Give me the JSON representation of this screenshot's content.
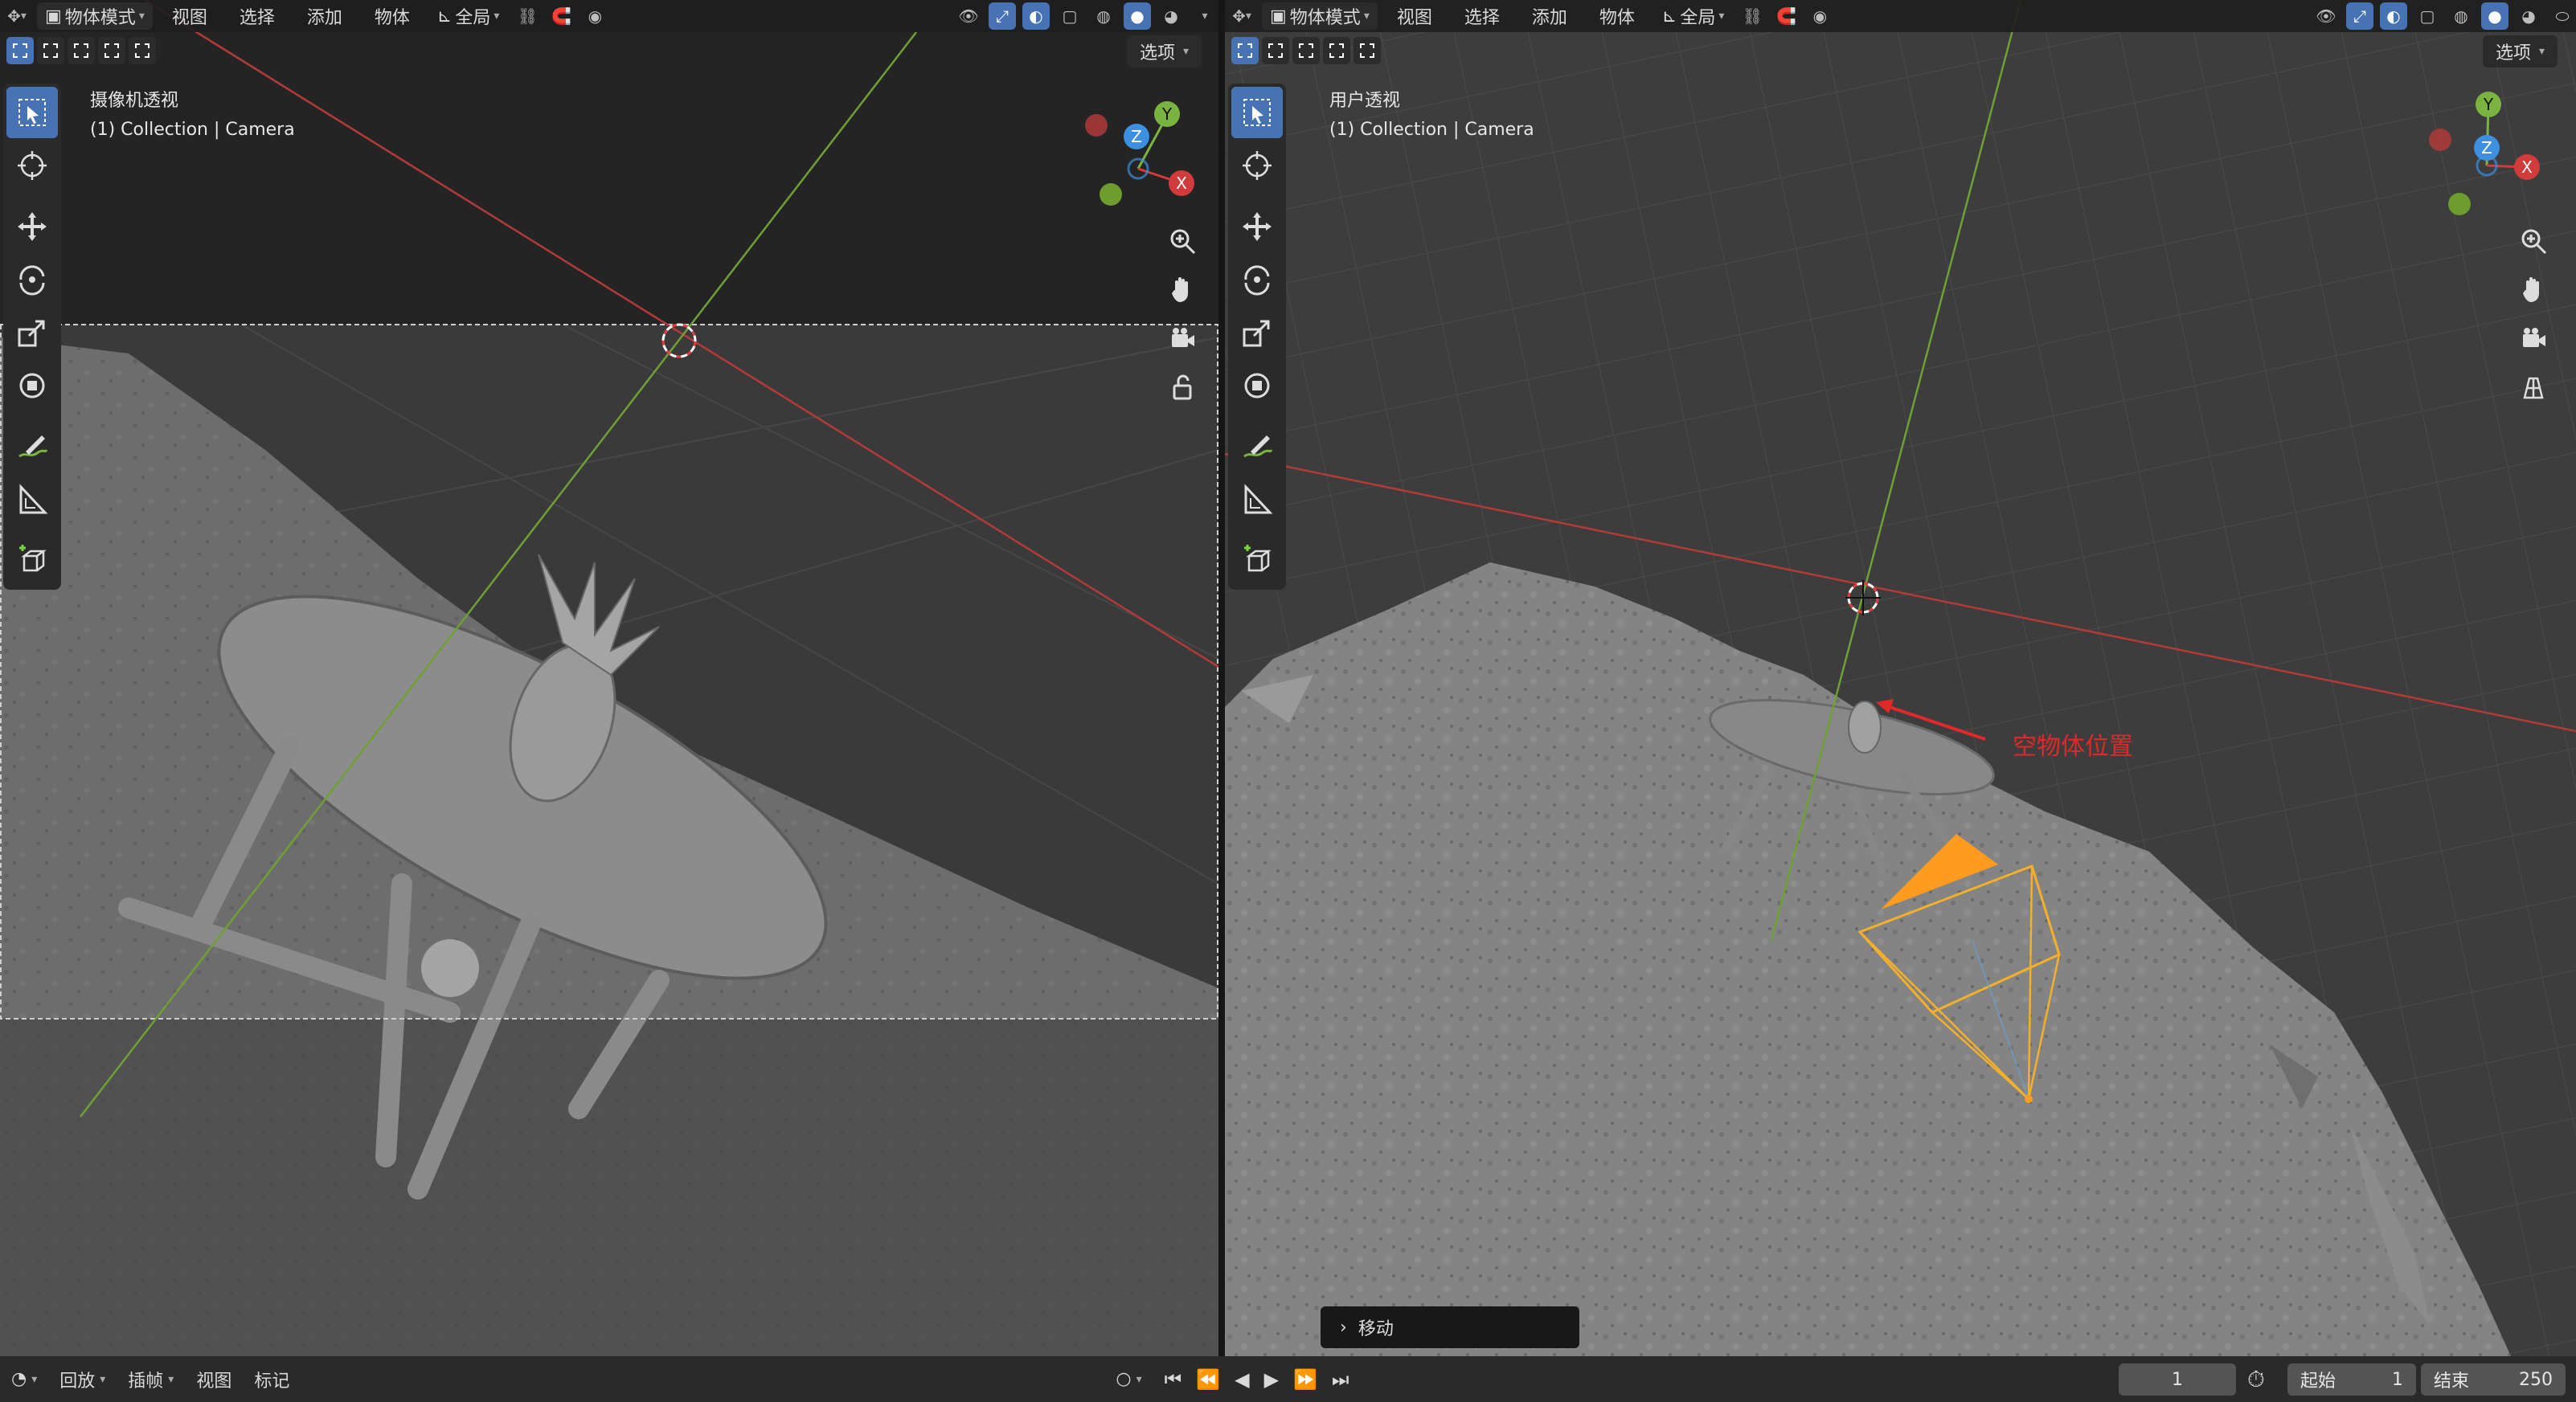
{
  "header": {
    "mode_label": "物体模式",
    "menus": [
      "视图",
      "选择",
      "添加",
      "物体"
    ],
    "transform_label": "全局",
    "options_label": "选项"
  },
  "left_viewport": {
    "title": "摄像机透视",
    "subtitle": "(1) Collection | Camera"
  },
  "right_viewport": {
    "title": "用户透视",
    "subtitle": "(1) Collection | Camera",
    "annotation": "空物体位置",
    "last_op_panel": "移动"
  },
  "gizmo_axes": {
    "x": "X",
    "y": "Y",
    "z": "Z"
  },
  "timeline": {
    "playback_label": "回放",
    "keying_label": "插帧",
    "view_label": "视图",
    "marker_label": "标记",
    "current_frame": "1",
    "start_label": "起始",
    "start_value": "1",
    "end_label": "结束",
    "end_value": "250"
  },
  "colors": {
    "accent": "#4772b3",
    "x_axis": "#d23b3b",
    "y_axis": "#7bb341",
    "z_axis": "#3d8fe0",
    "camera_orange": "#ff9b1e",
    "annotation_red": "#e02929"
  },
  "icons": [
    "select-box-icon",
    "cursor-icon",
    "move-icon",
    "rotate-icon",
    "scale-icon",
    "transform-icon",
    "annotate-icon",
    "measure-icon",
    "add-cube-icon",
    "zoom-icon",
    "hand-icon",
    "camera-view-icon",
    "lock-icon",
    "ortho-grid-icon",
    "play-icon",
    "stopwatch-icon"
  ]
}
